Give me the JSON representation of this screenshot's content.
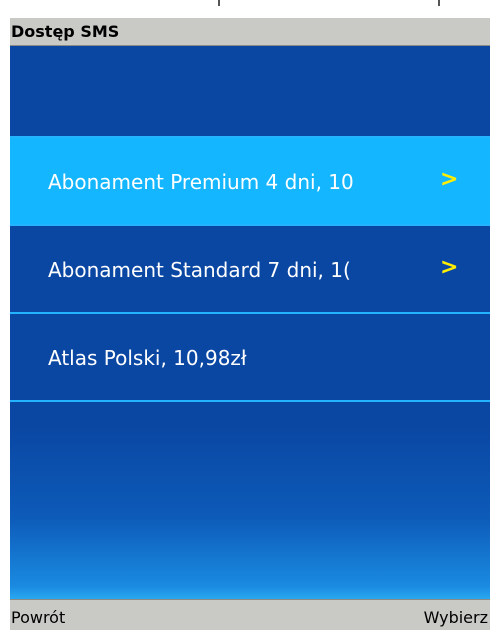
{
  "title": "Dostęp SMS",
  "menu": {
    "items": [
      {
        "label": "Abonament Premium 4 dni, 10",
        "has_submenu": true,
        "selected": true
      },
      {
        "label": "Abonament Standard 7 dni, 1(",
        "has_submenu": true,
        "selected": false
      },
      {
        "label": "Atlas Polski, 10,98zł",
        "has_submenu": false,
        "selected": false
      }
    ],
    "submenu_indicator": ">"
  },
  "softkeys": {
    "left": "Powrót",
    "right": "Wybierz"
  },
  "colors": {
    "background": "#0a47a3",
    "selected": "#14b6ff",
    "separator": "#23b4ff",
    "chevron": "#ffee00",
    "bars": "#c9c9c6"
  }
}
